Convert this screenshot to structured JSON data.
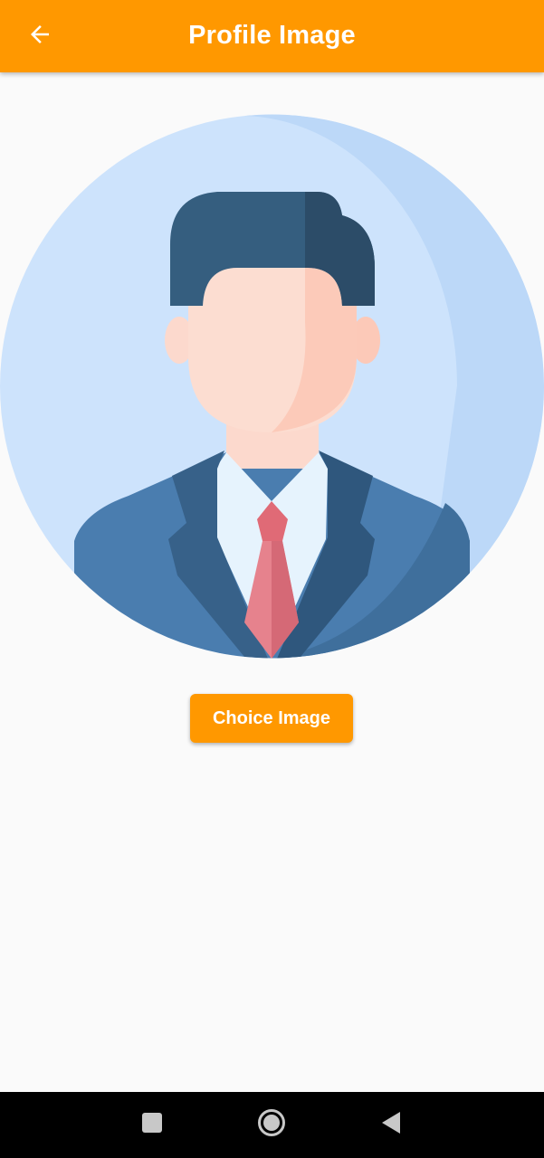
{
  "app_bar": {
    "title": "Profile Image",
    "back_icon": "arrow-left-icon",
    "background_color": "#ff9800"
  },
  "profile": {
    "avatar_icon": "businessman-avatar-icon"
  },
  "actions": {
    "choice_label": "Choice Image"
  },
  "system_nav": {
    "recents_icon": "square-icon",
    "home_icon": "circle-home-icon",
    "back_icon": "triangle-back-icon"
  }
}
